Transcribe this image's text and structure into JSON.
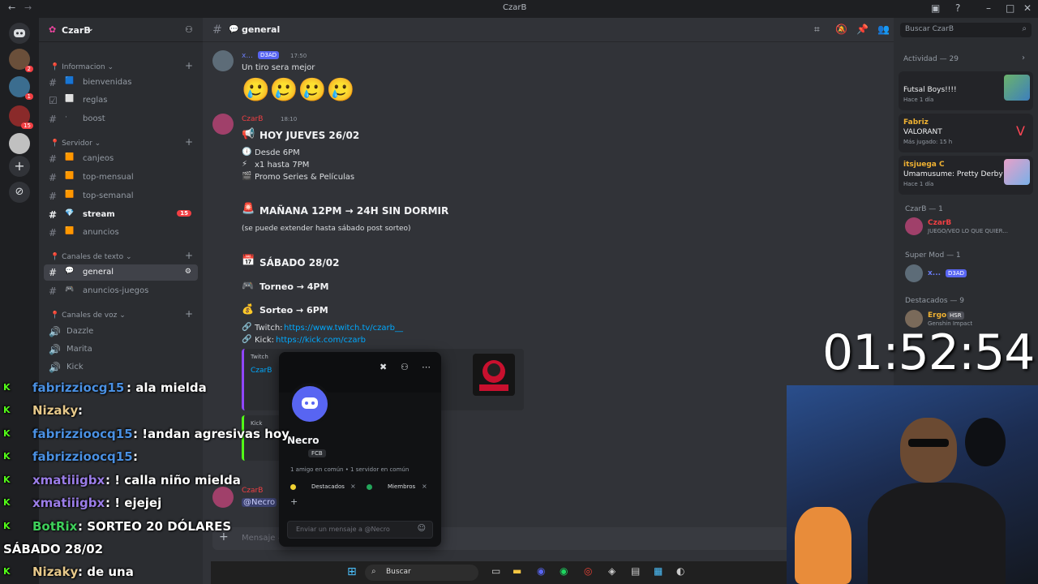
{
  "window": {
    "title": "CzarB"
  },
  "rail": {
    "badges": [
      "2",
      "1",
      "15"
    ]
  },
  "server": {
    "name": "CzarB"
  },
  "categories": {
    "info": "Informacion",
    "servidor": "Servidor",
    "texto": "Canales de texto",
    "voz": "Canales de voz"
  },
  "channels": {
    "bienvenidas": "bienvenidas",
    "reglas": "reglas",
    "boost": "boost",
    "canjeos": "canjeos",
    "top_mensual": "top-mensual",
    "top_semanal": "top-semanal",
    "stream": "stream",
    "stream_count": "15",
    "anuncios": "anuncios",
    "general": "general",
    "anuncios_juegos": "anuncios-juegos",
    "voice1": "Dazzle",
    "voice2": "Marita",
    "voice3": "Kick"
  },
  "channel_header": {
    "name": "general",
    "search_placeholder": "Buscar CzarB"
  },
  "messages": {
    "m1_author": "x...",
    "m1_tag": "D3AD",
    "m1_time": "17:50",
    "m1_text": "Un tiro sera mejor",
    "m2_author": "CzarB",
    "m2_time": "18:10",
    "m2_line1": "HOY JUEVES 26/02",
    "m2_line2": "Desde 6PM",
    "m2_line3": "x1 hasta 7PM",
    "m2_line4": "Promo Series & Películas",
    "m2_line5": "MAÑANA 12PM → 24H SIN DORMIR",
    "m2_line6": "(se puede extender hasta sábado post sorteo)",
    "m2_line7": "SÁBADO 28/02",
    "m2_line8": "Torneo → 4PM",
    "m2_line9": "Sorteo → 6PM",
    "m2_twitch_label": "Twitch:",
    "m2_twitch_link": "https://www.twitch.tv/czarb__",
    "m2_kick_label": "Kick:",
    "m2_kick_link": "https://kick.com/czarb",
    "embed_twitch": "Twitch",
    "embed_twitch_title": "CzarB",
    "embed_kick": "Kick",
    "m3_author": "CzarB",
    "m3_mention": "@Necro",
    "composer_placeholder": "Mensaje #"
  },
  "members": {
    "activity_title": "Actividad — 29",
    "act1_name": "Futsal Boys!!!!",
    "act1_when": "Hace 1 día",
    "act2_user": "Fabriz",
    "act2_game": "VALORANT",
    "act2_when": "Más jugado: 15 h",
    "act3_user": "itsjuega C",
    "act3_game": "Umamusume: Pretty Derby",
    "act3_when": "Hace 1 día",
    "role1": "CzarB — 1",
    "role1_member": "CzarB",
    "role1_status": "JUEGO/VEO LO QUE QUIER...",
    "role2": "Super Mod — 1",
    "role2_member": "x...",
    "role2_tag": "D3AD",
    "role3": "Destacados — 9",
    "role3_member": "Ergo",
    "role3_tag": "HSR",
    "role3_status": "Genshin Impact"
  },
  "popup": {
    "name": "Necro",
    "tag": "FCB",
    "mutual": "1 amigo en común • 1 servidor en común",
    "role1": "Destacados",
    "role2": "Miembros",
    "message_placeholder": "Enviar un mensaje a @Necro"
  },
  "overlay_chat": [
    {
      "user": "fabrizziocg15",
      "text": ": ala mielda",
      "color": "#4a90e2"
    },
    {
      "user": "Nizaky",
      "text": ":",
      "color": "#e6c88a"
    },
    {
      "user": "fabrizzioocq15",
      "text": ": !andan agresivas hoy",
      "color": "#4a90e2"
    },
    {
      "user": "fabrizzioocq15",
      "text": ":",
      "color": "#4a90e2"
    },
    {
      "user": "xmatiiigbx",
      "text": ": ! calla niño mielda",
      "color": "#9b7de8"
    },
    {
      "user": "xmatiiigbx",
      "text": ": ! ejejej",
      "color": "#9b7de8"
    },
    {
      "user": "BotRix",
      "text": ": SORTEO 20 DÓLARES",
      "color": "#3ecf5a"
    },
    {
      "user": "",
      "text": "SÁBADO 28/02",
      "color": "#ffffff"
    },
    {
      "user": "Nizaky",
      "text": ": de una",
      "color": "#e6c88a"
    }
  ],
  "timer": "01:52:54",
  "taskbar": {
    "search": "Buscar"
  },
  "colors": {
    "accent": "#5865f2",
    "czarb": "#f23f43",
    "link": "#00a8fc",
    "online": "#23a55a"
  }
}
